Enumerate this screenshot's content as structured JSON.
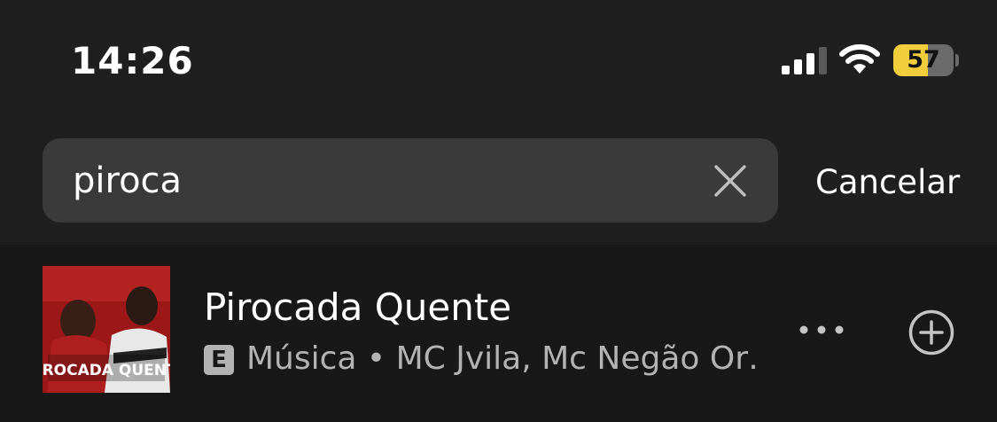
{
  "status_bar": {
    "time": "14:26",
    "battery_level": "57",
    "battery_fraction": 0.57,
    "icons": [
      "cellular-signal-icon",
      "wifi-icon",
      "battery-icon"
    ]
  },
  "search": {
    "query": "piroca",
    "cancel_label": "Cancelar"
  },
  "results": [
    {
      "title": "Pirocada Quente",
      "explicit_badge": "E",
      "subtitle": "Música • MC Jvila, Mc Negão Or…",
      "cover_text": "PIROCADA QUENTE"
    }
  ],
  "colors": {
    "background": "#1f1f1f",
    "results_background": "#181818",
    "search_field": "#3a3a3a",
    "secondary_text": "#b3b3b3",
    "battery_fill": "#f2cd3c"
  }
}
